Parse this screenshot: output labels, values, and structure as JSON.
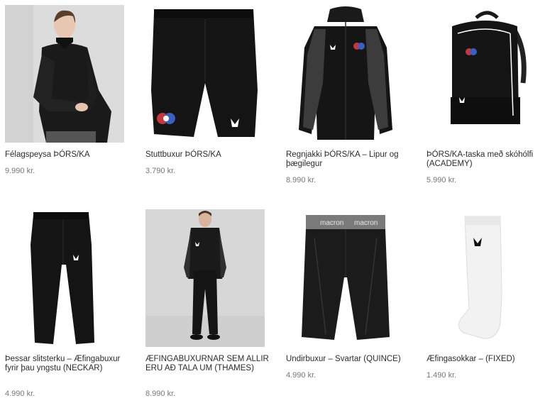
{
  "products": [
    {
      "name": "Félagspeysa ÞÓRS/KA",
      "price": "9.990 kr.",
      "image": "black-quarter-zip-sweater-model-photo"
    },
    {
      "name": "Stuttbuxur ÞÓRS/KA",
      "price": "3.790 kr.",
      "image": "black-shorts"
    },
    {
      "name": "Regnjakki ÞÓRS/KA – Lipur og þægilegur",
      "price": "8.990 kr.",
      "image": "black-rain-jacket"
    },
    {
      "name": "ÞÓRS/KA-taska með skóhólfi (ACADEMY)",
      "price": "5.990 kr.",
      "image": "black-backpack"
    },
    {
      "name": "Þessar slitsterku – Æfingabuxur fyrir þau yngstu (NECKAR)",
      "price": "4.990 kr.",
      "image": "black-training-pants"
    },
    {
      "name": "ÆFINGABUXURNAR SEM ALLIR ERU AÐ TALA UM (THAMES)",
      "price": "8.990 kr.",
      "image": "black-tracksuit-model-photo"
    },
    {
      "name": "Undirbuxur – Svartar (QUINCE)",
      "price": "4.990 kr.",
      "image": "black-compression-shorts",
      "waistband_text": "macron"
    },
    {
      "name": "Æfingasokkar – (FIXED)",
      "price": "1.490 kr.",
      "image": "white-sock"
    }
  ],
  "colors": {
    "text": "#2b2b2b",
    "price": "#777777",
    "garment": "#141414",
    "photo_bg": "#d9d9d9"
  }
}
